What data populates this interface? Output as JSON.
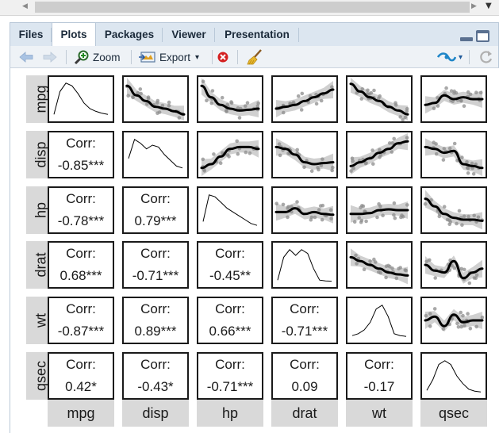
{
  "window": {
    "tabs": [
      {
        "label": "Files",
        "active": false
      },
      {
        "label": "Plots",
        "active": true
      },
      {
        "label": "Packages",
        "active": false
      },
      {
        "label": "Viewer",
        "active": false
      },
      {
        "label": "Presentation",
        "active": false
      }
    ]
  },
  "toolbar": {
    "zoom_label": "Zoom",
    "export_label": "Export",
    "export_caret": "▾",
    "icons": [
      "back-arrow-icon",
      "forward-arrow-icon",
      "zoom-icon",
      "export-icon",
      "remove-plot-icon",
      "broom-icon",
      "publish-icon",
      "refresh-icon"
    ]
  },
  "plot": {
    "variables": [
      "mpg",
      "disp",
      "hp",
      "drat",
      "wt",
      "qsec"
    ],
    "correlations": [
      {
        "row": 1,
        "col": 0,
        "label": "Corr:",
        "value": "-0.85***"
      },
      {
        "row": 2,
        "col": 0,
        "label": "Corr:",
        "value": "-0.78***"
      },
      {
        "row": 2,
        "col": 1,
        "label": "Corr:",
        "value": "0.79***"
      },
      {
        "row": 3,
        "col": 0,
        "label": "Corr:",
        "value": "0.68***"
      },
      {
        "row": 3,
        "col": 1,
        "label": "Corr:",
        "value": "-0.71***"
      },
      {
        "row": 3,
        "col": 2,
        "label": "Corr:",
        "value": "-0.45**"
      },
      {
        "row": 4,
        "col": 0,
        "label": "Corr:",
        "value": "-0.87***"
      },
      {
        "row": 4,
        "col": 1,
        "label": "Corr:",
        "value": "0.89***"
      },
      {
        "row": 4,
        "col": 2,
        "label": "Corr:",
        "value": "0.66***"
      },
      {
        "row": 4,
        "col": 3,
        "label": "Corr:",
        "value": "-0.71***"
      },
      {
        "row": 5,
        "col": 0,
        "label": "Corr:",
        "value": "0.42*"
      },
      {
        "row": 5,
        "col": 1,
        "label": "Corr:",
        "value": "-0.43*"
      },
      {
        "row": 5,
        "col": 2,
        "label": "Corr:",
        "value": "-0.71***"
      },
      {
        "row": 5,
        "col": 3,
        "label": "Corr:",
        "value": "0.09"
      },
      {
        "row": 5,
        "col": 4,
        "label": "Corr:",
        "value": "-0.17"
      }
    ],
    "colors": {
      "smooth_line": "#000000",
      "ribbon": "#c8c8c8",
      "points": "#8c8c8c",
      "strip": "#d9d9d9"
    }
  }
}
